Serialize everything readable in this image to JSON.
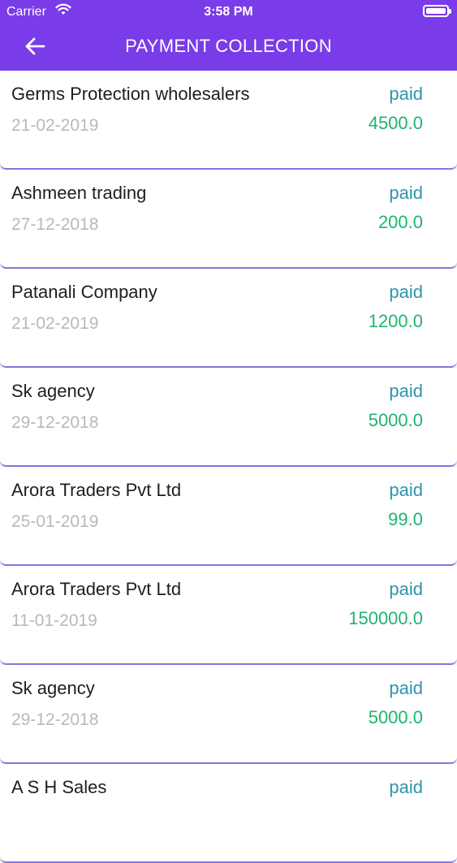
{
  "status_bar": {
    "carrier": "Carrier",
    "time": "3:58 PM",
    "wifi_icon": "wifi-icon",
    "battery_icon": "battery-icon"
  },
  "header": {
    "title": "PAYMENT COLLECTION",
    "back_icon": "back-arrow-icon",
    "background_color": "#7a3be8"
  },
  "colors": {
    "status_paid": "#2e95ab",
    "amount": "#1db56f",
    "date": "#b9b9b9",
    "divider": "#8b73e0"
  },
  "payments": [
    {
      "name": "Germs Protection wholesalers",
      "date": "21-02-2019",
      "status": "paid",
      "amount": "4500.0"
    },
    {
      "name": "Ashmeen trading",
      "date": "27-12-2018",
      "status": "paid",
      "amount": "200.0"
    },
    {
      "name": "Patanali Company",
      "date": "21-02-2019",
      "status": "paid",
      "amount": "1200.0"
    },
    {
      "name": "Sk agency",
      "date": "29-12-2018",
      "status": "paid",
      "amount": "5000.0"
    },
    {
      "name": "Arora Traders Pvt Ltd",
      "date": "25-01-2019",
      "status": "paid",
      "amount": "99.0"
    },
    {
      "name": "Arora Traders Pvt Ltd",
      "date": "11-01-2019",
      "status": "paid",
      "amount": "150000.0"
    },
    {
      "name": "Sk agency",
      "date": "29-12-2018",
      "status": "paid",
      "amount": "5000.0"
    },
    {
      "name": "A S H Sales",
      "date": "",
      "status": "paid",
      "amount": ""
    }
  ]
}
